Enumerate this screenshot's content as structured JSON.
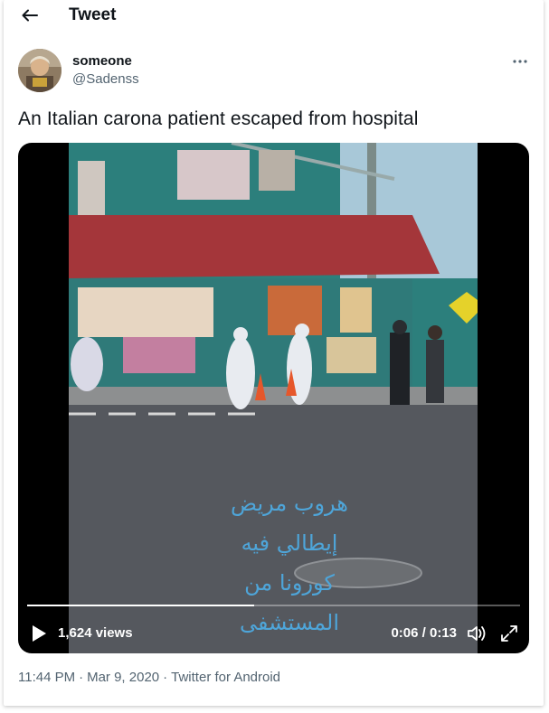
{
  "header": {
    "title": "Tweet"
  },
  "author": {
    "display_name": "someone",
    "handle": "@Sadenss"
  },
  "tweet": {
    "text": "An Italian carona patient escaped from hospital"
  },
  "video": {
    "overlay_lines": [
      "هروب مريض",
      "إيطالي فيه",
      "كورونا من",
      "المستشفى"
    ],
    "views": "1,624 views",
    "time": "0:06 / 0:13",
    "progress": 0.46
  },
  "meta": {
    "time": "11:44 PM",
    "date": "Mar 9, 2020",
    "source": "Twitter for Android",
    "separator": "·"
  },
  "icons": {
    "back": "back-arrow-icon",
    "more": "more-dots-icon",
    "play": "play-icon",
    "volume": "volume-icon",
    "fullscreen": "fullscreen-icon"
  }
}
